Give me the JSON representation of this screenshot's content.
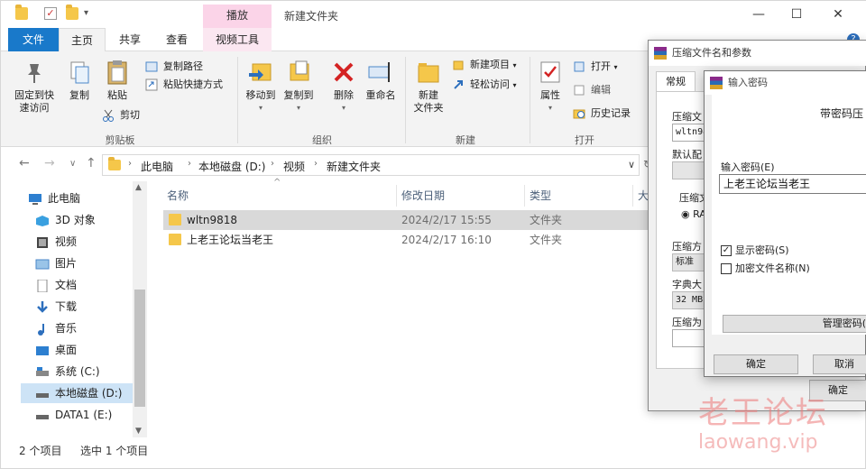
{
  "window": {
    "title": "新建文件夹",
    "tool_tab_header": "播放",
    "minimize": "—",
    "maximize": "☐",
    "close": "✕"
  },
  "ribbon_tabs": [
    "文件",
    "主页",
    "共享",
    "查看",
    "视频工具"
  ],
  "help": "?",
  "ribbon": {
    "clipboard": {
      "pin_quick_access": [
        "固定到快",
        "速访问"
      ],
      "copy": "复制",
      "paste": "粘贴",
      "copy_path": "复制路径",
      "paste_shortcut": "粘贴快捷方式",
      "cut": "剪切",
      "group_label": "剪贴板"
    },
    "organize": {
      "move_to": "移动到",
      "copy_to": "复制到",
      "delete": "删除",
      "rename": "重命名",
      "group_label": "组织"
    },
    "new": {
      "new_folder": [
        "新建",
        "文件夹"
      ],
      "new_item": "新建项目",
      "easy_access": "轻松访问",
      "group_label": "新建"
    },
    "open": {
      "properties": "属性",
      "open": "打开",
      "edit": "编辑",
      "history": "历史记录",
      "group_label": "打开"
    }
  },
  "breadcrumb": [
    "此电脑",
    "本地磁盘 (D:)",
    "视频",
    "新建文件夹"
  ],
  "nav_pane": [
    {
      "label": "此电脑",
      "icon": "computer-icon"
    },
    {
      "label": "3D 对象",
      "icon": "3d-objects-icon"
    },
    {
      "label": "视频",
      "icon": "video-icon"
    },
    {
      "label": "图片",
      "icon": "pictures-icon"
    },
    {
      "label": "文档",
      "icon": "documents-icon"
    },
    {
      "label": "下载",
      "icon": "download-icon"
    },
    {
      "label": "音乐",
      "icon": "music-icon"
    },
    {
      "label": "桌面",
      "icon": "desktop-icon"
    },
    {
      "label": "系统 (C:)",
      "icon": "drive-icon"
    },
    {
      "label": "本地磁盘 (D:)",
      "icon": "drive-icon",
      "selected": true
    },
    {
      "label": "DATA1 (E:)",
      "icon": "drive-icon"
    }
  ],
  "columns": {
    "name": "名称",
    "date": "修改日期",
    "type": "类型",
    "size": "大"
  },
  "files": [
    {
      "name": "wltn9818",
      "date": "2024/2/17 15:55",
      "type": "文件夹",
      "selected": true
    },
    {
      "name": "上老王论坛当老王",
      "date": "2024/2/17 16:10",
      "type": "文件夹",
      "selected": false
    }
  ],
  "status": {
    "count": "2 个项目",
    "selected": "选中 1 个项目"
  },
  "archive_dialog": {
    "title": "压缩文件名和参数",
    "tab": "常规",
    "archive_name_label": "压缩文",
    "archive_name_value": "wltn98",
    "default_config_label": "默认配",
    "format_label": "压缩文",
    "format_option": "RA",
    "method_label": "压缩方",
    "method_value": "标准",
    "dict_label": "字典大",
    "dict_value": "32 MB",
    "split_label": "压缩为",
    "ok": "确定"
  },
  "password_dialog": {
    "title": "输入密码",
    "heading": "带密码压",
    "input_label": "输入密码(E)",
    "password_value": "上老王论坛当老王",
    "show_password": "显示密码(S)",
    "show_password_checked": true,
    "encrypt_names": "加密文件名称(N)",
    "encrypt_names_checked": false,
    "manage_button": "管理密码(",
    "ok": "确定",
    "cancel": "取消"
  },
  "watermark": {
    "cn": "老王论坛",
    "en": "laowang.vip"
  },
  "colors": {
    "accent": "#1979ca",
    "selection": "#d9d9d9",
    "nav_selected": "#cde3f6",
    "tool_tab": "#fbd4e8",
    "watermark": "#ec7878"
  }
}
